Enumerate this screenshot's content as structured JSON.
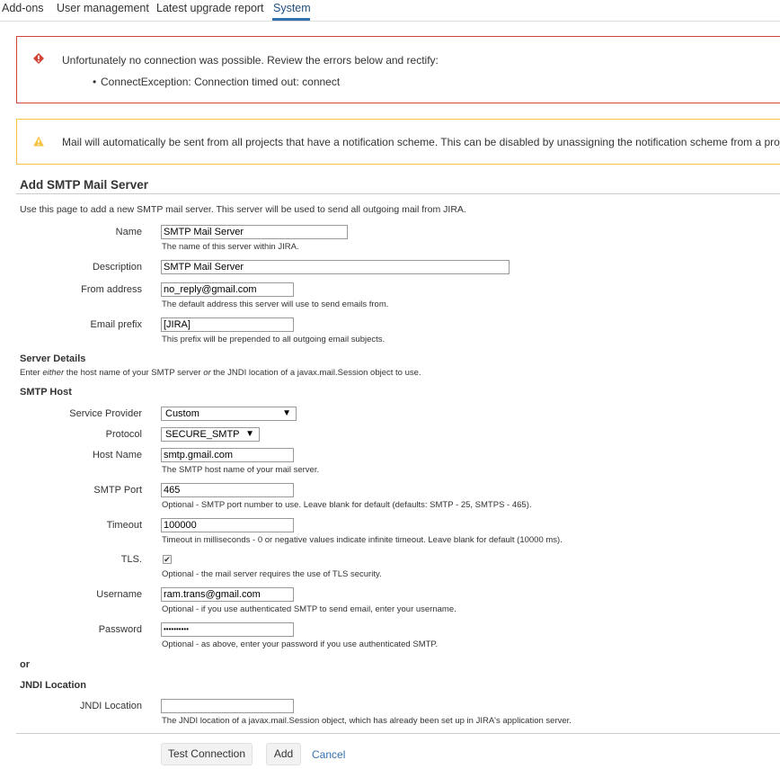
{
  "tabs": [
    "Add-ons",
    "User management",
    "Latest upgrade report",
    "System"
  ],
  "active_tab": "System",
  "error": {
    "title": "Unfortunately no connection was possible. Review the errors below and rectify:",
    "item": "ConnectException: Connection timed out: connect",
    "color": "#d04437"
  },
  "warning": {
    "text": "Mail will automatically be sent from all projects that have a notification scheme. This can be disabled by unassigning the notification scheme from a project.",
    "color": "#f6c342"
  },
  "section": {
    "title": "Add SMTP Mail Server",
    "description": "Use this page to add a new SMTP mail server. This server will be used to send all outgoing mail from JIRA."
  },
  "fields": {
    "name": {
      "label": "Name",
      "value": "SMTP Mail Server",
      "hint": "The name of this server within JIRA."
    },
    "description": {
      "label": "Description",
      "value": "SMTP Mail Server"
    },
    "from_address": {
      "label": "From address",
      "value": "no_reply@gmail.com",
      "hint": "The default address this server will use to send emails from."
    },
    "email_prefix": {
      "label": "Email prefix",
      "value": "[JIRA]",
      "hint": "This prefix will be prepended to all outgoing email subjects."
    }
  },
  "server_details": {
    "title": "Server Details",
    "note_pre": "Enter ",
    "note_em1": "either",
    "note_mid": " the host name of your SMTP server ",
    "note_em2": "or",
    "note_post": " the JNDI location of a javax.mail.Session object to use."
  },
  "smtp_host": {
    "title": "SMTP Host",
    "service_provider": {
      "label": "Service Provider",
      "value": "Custom"
    },
    "protocol": {
      "label": "Protocol",
      "value": "SECURE_SMTP"
    },
    "host_name": {
      "label": "Host Name",
      "value": "smtp.gmail.com",
      "hint": "The SMTP host name of your mail server."
    },
    "port": {
      "label": "SMTP Port",
      "value": "465",
      "hint": "Optional - SMTP port number to use. Leave blank for default (defaults: SMTP - 25, SMTPS - 465)."
    },
    "timeout": {
      "label": "Timeout",
      "value": "100000",
      "hint": "Timeout in milliseconds - 0 or negative values indicate infinite timeout. Leave blank for default (10000 ms)."
    },
    "tls": {
      "label": "TLS.",
      "checked": true,
      "hint": "Optional - the mail server requires the use of TLS security."
    },
    "username": {
      "label": "Username",
      "value": "ram.trans@gmail.com",
      "hint": "Optional - if you use authenticated SMTP to send email, enter your username."
    },
    "password": {
      "label": "Password",
      "value": "••••••••••",
      "hint": "Optional - as above, enter your password if you use authenticated SMTP."
    }
  },
  "or_label": "or",
  "jndi": {
    "title": "JNDI Location",
    "label": "JNDI Location",
    "value": "",
    "hint": "The JNDI location of a javax.mail.Session object, which has already been set up in JIRA's application server."
  },
  "buttons": {
    "test_connection": "Test Connection",
    "add": "Add",
    "cancel": "Cancel"
  }
}
